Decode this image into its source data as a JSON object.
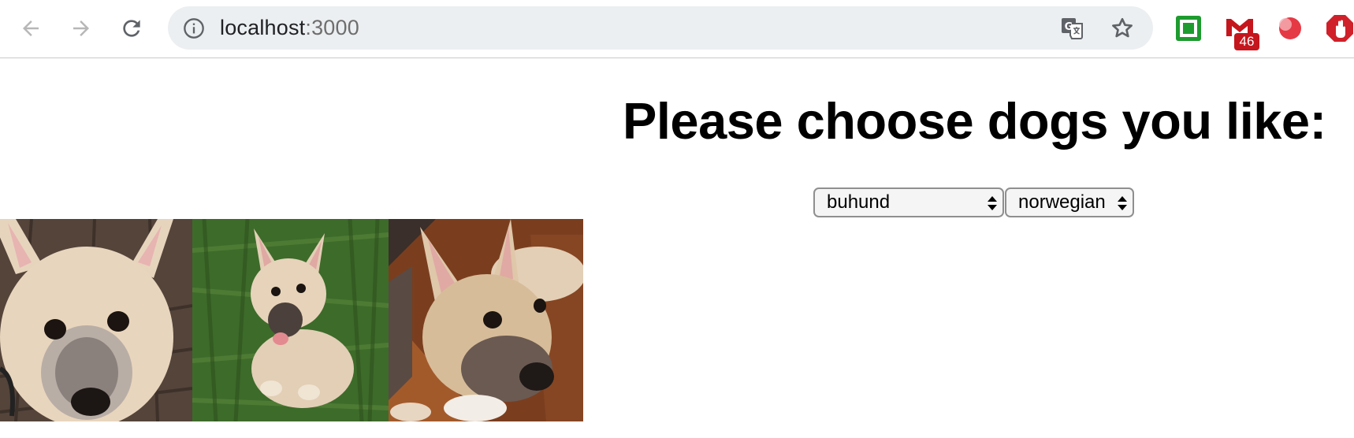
{
  "browser": {
    "url_host": "localhost",
    "url_port": ":3000",
    "extensions": [
      {
        "name": "green-square-extension",
        "color": "#1e9b2f"
      },
      {
        "name": "gmail-extension",
        "color": "#c5161d",
        "badge": "46"
      },
      {
        "name": "red-circle-extension",
        "color": "#e53946"
      },
      {
        "name": "adblock-extension",
        "color": "#d0202a"
      }
    ]
  },
  "page": {
    "heading": "Please choose dogs you like:",
    "breed_select": {
      "selected": "buhund"
    },
    "subbreed_select": {
      "selected": "norwegian"
    },
    "images": [
      {
        "alt": "buhund puppy close-up"
      },
      {
        "alt": "buhund puppy sitting on grass"
      },
      {
        "alt": "buhund puppy lying on wood floor"
      }
    ]
  },
  "colors": {
    "toolbar_bg": "#ffffff",
    "omnibox_bg": "#eceff1",
    "heading": "#000000"
  }
}
